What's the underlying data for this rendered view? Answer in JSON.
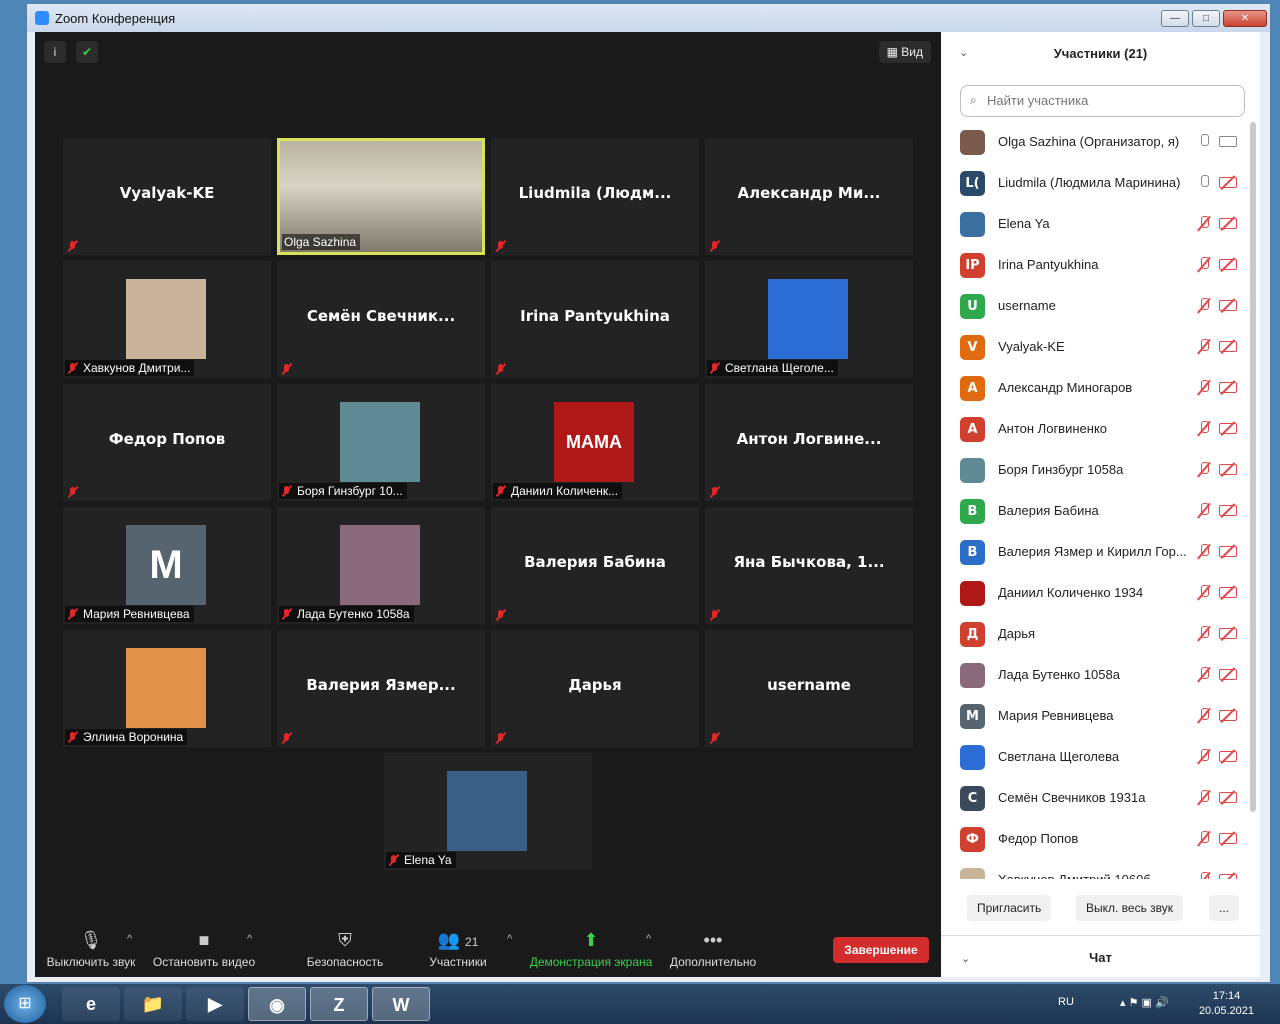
{
  "window": {
    "title": "Zoom Конференция",
    "minimize": "—",
    "restore": "□",
    "close": "✕"
  },
  "top": {
    "info_icon": "i",
    "shield_icon": "✔",
    "view_label": "Вид"
  },
  "tiles": [
    {
      "label": "Vyalyak-KE",
      "type": "name",
      "row": 0,
      "col": 0
    },
    {
      "label": "Olga Sazhina",
      "type": "video",
      "row": 0,
      "col": 1,
      "active": true
    },
    {
      "label": "Liudmila (Людм...",
      "type": "name",
      "row": 0,
      "col": 2
    },
    {
      "label": "Александр Ми...",
      "type": "name",
      "row": 0,
      "col": 3
    },
    {
      "label": "Хавкунов Дмитри...",
      "type": "photo",
      "row": 1,
      "col": 0,
      "thumb": "#c9b49b"
    },
    {
      "label": "Семён Свечник...",
      "type": "name",
      "row": 1,
      "col": 1
    },
    {
      "label": "Irina Pantyukhina",
      "type": "name",
      "row": 1,
      "col": 2
    },
    {
      "label": "Светлана Щеголе...",
      "type": "photo",
      "row": 1,
      "col": 3,
      "thumb": "#2c6dd5"
    },
    {
      "label": "Федор Попов",
      "type": "name",
      "row": 2,
      "col": 0
    },
    {
      "label": "Боря Гинзбург 10...",
      "type": "photo",
      "row": 2,
      "col": 1,
      "thumb": "#5f8a93"
    },
    {
      "label": "Даниил Количенк...",
      "type": "photo",
      "row": 2,
      "col": 2,
      "thumb": "#b01818",
      "thumb_text": "МАМА"
    },
    {
      "label": "Антон Логвине...",
      "type": "name",
      "row": 2,
      "col": 3
    },
    {
      "label": "Мария Ревнивцева",
      "type": "photo",
      "row": 3,
      "col": 0,
      "thumb": "#566470",
      "thumb_text": "M"
    },
    {
      "label": "Лада Бутенко 1058а",
      "type": "photo",
      "row": 3,
      "col": 1,
      "thumb": "#8a6a7a"
    },
    {
      "label": "Валерия Бабина",
      "type": "name",
      "row": 3,
      "col": 2
    },
    {
      "label": "Яна Бычкова, 1...",
      "type": "name",
      "row": 3,
      "col": 3
    },
    {
      "label": "Эллина Воронина",
      "type": "photo",
      "row": 4,
      "col": 0,
      "thumb": "#e0914a"
    },
    {
      "label": "Валерия Язмер...",
      "type": "name",
      "row": 4,
      "col": 1
    },
    {
      "label": "Дарья",
      "type": "name",
      "row": 4,
      "col": 2
    },
    {
      "label": "username",
      "type": "name",
      "row": 4,
      "col": 3
    },
    {
      "label": "Elena Ya",
      "type": "photo",
      "row": 5,
      "col": 1.5,
      "thumb": "#3a5f86"
    }
  ],
  "toolbar": {
    "mute": "Выключить звук",
    "video": "Остановить видео",
    "security": "Безопасность",
    "participants": "Участники",
    "participants_count": "21",
    "share": "Демонстрация экрана",
    "more": "Дополнительно",
    "end": "Завершение"
  },
  "panel": {
    "title": "Участники (21)",
    "search_placeholder": "Найти участника",
    "invite": "Пригласить",
    "mute_all": "Выкл. весь звук",
    "more": "...",
    "chat": "Чат",
    "participants": [
      {
        "name": "Olga Sazhina (Организатор, я)",
        "avatar": "",
        "color": "#7a5a4a",
        "mic": "on",
        "cam": "on"
      },
      {
        "name": "Liudmila (Людмила Маринина)",
        "avatar": "L(",
        "color": "#2a4a6a",
        "mic": "on",
        "cam": "off"
      },
      {
        "name": "Elena Ya",
        "avatar": "",
        "color": "#3a6fa0",
        "mic": "off",
        "cam": "off"
      },
      {
        "name": "Irina Pantyukhina",
        "avatar": "IP",
        "color": "#d0402f",
        "mic": "off",
        "cam": "off"
      },
      {
        "name": "username",
        "avatar": "U",
        "color": "#2ea84a",
        "mic": "off",
        "cam": "off"
      },
      {
        "name": "Vyalyak-KE",
        "avatar": "V",
        "color": "#e06a10",
        "mic": "off",
        "cam": "off"
      },
      {
        "name": "Александр Миногаров",
        "avatar": "А",
        "color": "#e06a10",
        "mic": "off",
        "cam": "off"
      },
      {
        "name": "Антон Логвиненко",
        "avatar": "А",
        "color": "#d0402f",
        "mic": "off",
        "cam": "off"
      },
      {
        "name": "Боря Гинзбург 1058а",
        "avatar": "",
        "color": "#5f8a93",
        "mic": "off",
        "cam": "off"
      },
      {
        "name": "Валерия Бабина",
        "avatar": "В",
        "color": "#2ea84a",
        "mic": "off",
        "cam": "off"
      },
      {
        "name": "Валерия Язмер и Кирилл Гор...",
        "avatar": "В",
        "color": "#2a6ec8",
        "mic": "off",
        "cam": "off"
      },
      {
        "name": "Даниил Количенко 1934",
        "avatar": "",
        "color": "#b01818",
        "mic": "off",
        "cam": "off"
      },
      {
        "name": "Дарья",
        "avatar": "Д",
        "color": "#d0402f",
        "mic": "off",
        "cam": "off"
      },
      {
        "name": "Лада Бутенко 1058а",
        "avatar": "",
        "color": "#8a6a7a",
        "mic": "off",
        "cam": "off"
      },
      {
        "name": "Мария Ревнивцева",
        "avatar": "M",
        "color": "#566470",
        "mic": "off",
        "cam": "off"
      },
      {
        "name": "Светлана Щеголева",
        "avatar": "",
        "color": "#2c6dd5",
        "mic": "off",
        "cam": "off"
      },
      {
        "name": "Семён Свечников 1931а",
        "avatar": "С",
        "color": "#3a4a5a",
        "mic": "off",
        "cam": "off"
      },
      {
        "name": "Федор Попов",
        "avatar": "Ф",
        "color": "#d0402f",
        "mic": "off",
        "cam": "off"
      },
      {
        "name": "Хавкунов Дмитрий 1060б",
        "avatar": "",
        "color": "#c9b49b",
        "mic": "off",
        "cam": "off"
      }
    ]
  },
  "taskbar": {
    "lang": "RU",
    "time": "17:14",
    "date": "20.05.2021",
    "apps": [
      "e",
      "📁",
      "▶",
      "◉",
      "Z",
      "W"
    ]
  }
}
